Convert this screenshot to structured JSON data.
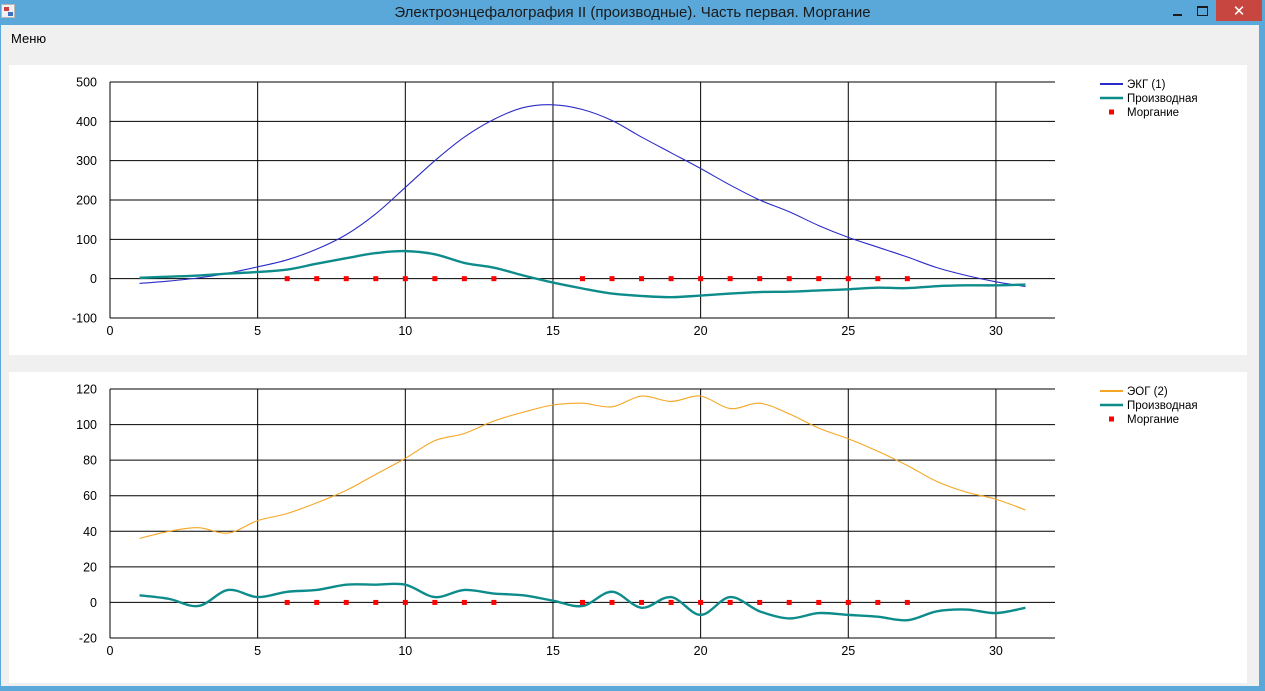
{
  "window": {
    "title": "Электроэнцефалография II (производные). Часть первая. Моргание",
    "minimize_icon": "minimize-icon",
    "maximize_icon": "maximize-icon",
    "close_icon": "close-icon",
    "close_glyph": "✕"
  },
  "menu": {
    "items": [
      {
        "label": "Меню"
      }
    ]
  },
  "colors": {
    "frame": "#5aa7d9",
    "ekg": "#2b2bc7",
    "eog": "#f5a623",
    "derivative": "#0e8c8c",
    "blink": "#ff0000"
  },
  "chart_data": [
    {
      "type": "line",
      "xlim": [
        0,
        32
      ],
      "ylim": [
        -100,
        500
      ],
      "x_ticks": [
        0,
        5,
        10,
        15,
        20,
        25,
        30
      ],
      "y_ticks": [
        -100,
        0,
        100,
        200,
        300,
        400,
        500
      ],
      "grid": true,
      "legend_position": "top-right",
      "series": [
        {
          "name": "ЭКГ (1)",
          "style": "thin-line",
          "color": "#2b2bc7",
          "x": [
            1,
            2,
            3,
            4,
            5,
            6,
            7,
            8,
            9,
            10,
            11,
            12,
            13,
            14,
            15,
            16,
            17,
            18,
            19,
            20,
            21,
            22,
            23,
            24,
            25,
            26,
            27,
            28,
            29,
            30,
            31
          ],
          "y": [
            -12,
            -6,
            2,
            14,
            30,
            48,
            75,
            112,
            165,
            232,
            300,
            360,
            405,
            435,
            442,
            430,
            402,
            360,
            320,
            280,
            238,
            200,
            170,
            135,
            105,
            80,
            55,
            28,
            8,
            -8,
            -20
          ]
        },
        {
          "name": "Производная",
          "style": "thick-line",
          "color": "#0e8c8c",
          "x": [
            1,
            2,
            3,
            4,
            5,
            6,
            7,
            8,
            9,
            10,
            11,
            12,
            13,
            14,
            15,
            16,
            17,
            18,
            19,
            20,
            21,
            22,
            23,
            24,
            25,
            26,
            27,
            28,
            29,
            30,
            31
          ],
          "y": [
            2,
            5,
            8,
            13,
            17,
            23,
            38,
            52,
            65,
            70,
            62,
            40,
            28,
            8,
            -10,
            -25,
            -38,
            -44,
            -47,
            -43,
            -38,
            -34,
            -33,
            -30,
            -27,
            -23,
            -24,
            -19,
            -17,
            -17,
            -15
          ]
        },
        {
          "name": "Моргание",
          "style": "markers",
          "color": "#ff0000",
          "x": [
            6,
            7,
            8,
            9,
            10,
            11,
            12,
            13,
            16,
            17,
            18,
            19,
            20,
            21,
            22,
            23,
            24,
            25,
            26,
            27
          ],
          "y": [
            0,
            0,
            0,
            0,
            0,
            0,
            0,
            0,
            0,
            0,
            0,
            0,
            0,
            0,
            0,
            0,
            0,
            0,
            0,
            0
          ]
        }
      ]
    },
    {
      "type": "line",
      "xlim": [
        0,
        32
      ],
      "ylim": [
        -20,
        120
      ],
      "x_ticks": [
        0,
        5,
        10,
        15,
        20,
        25,
        30
      ],
      "y_ticks": [
        -20,
        0,
        20,
        40,
        60,
        80,
        100,
        120
      ],
      "grid": true,
      "legend_position": "top-right",
      "series": [
        {
          "name": "ЭОГ (2)",
          "style": "thin-line",
          "color": "#f5a623",
          "x": [
            1,
            2,
            3,
            4,
            5,
            6,
            7,
            8,
            9,
            10,
            11,
            12,
            13,
            14,
            15,
            16,
            17,
            18,
            19,
            20,
            21,
            22,
            23,
            24,
            25,
            26,
            27,
            28,
            29,
            30,
            31
          ],
          "y": [
            36,
            40,
            42,
            39,
            46,
            50,
            56,
            63,
            72,
            81,
            91,
            95,
            102,
            107,
            111,
            112,
            110,
            116,
            113,
            116,
            109,
            112,
            106,
            98,
            92,
            85,
            77,
            68,
            62,
            58,
            52
          ]
        },
        {
          "name": "Производная",
          "style": "thick-line",
          "color": "#0e8c8c",
          "x": [
            1,
            2,
            3,
            4,
            5,
            6,
            7,
            8,
            9,
            10,
            11,
            12,
            13,
            14,
            15,
            16,
            17,
            18,
            19,
            20,
            21,
            22,
            23,
            24,
            25,
            26,
            27,
            28,
            29,
            30,
            31
          ],
          "y": [
            4,
            2,
            -2,
            7,
            3,
            6,
            7,
            10,
            10,
            10,
            3,
            7,
            5,
            4,
            1,
            -2,
            6,
            -3,
            3,
            -7,
            3,
            -5,
            -9,
            -6,
            -7,
            -8,
            -10,
            -5,
            -4,
            -6,
            -3
          ]
        },
        {
          "name": "Моргание",
          "style": "markers",
          "color": "#ff0000",
          "x": [
            6,
            7,
            8,
            9,
            10,
            11,
            12,
            13,
            16,
            17,
            18,
            19,
            20,
            21,
            22,
            23,
            24,
            25,
            26,
            27
          ],
          "y": [
            0,
            0,
            0,
            0,
            0,
            0,
            0,
            0,
            0,
            0,
            0,
            0,
            0,
            0,
            0,
            0,
            0,
            0,
            0,
            0
          ]
        }
      ]
    }
  ]
}
